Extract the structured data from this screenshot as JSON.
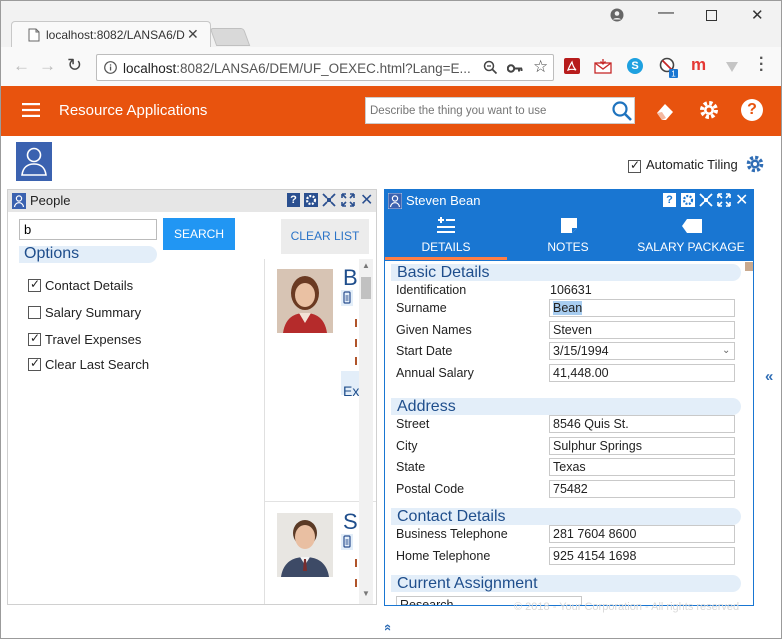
{
  "browser": {
    "tab_title": "localhost:8082/LANSA6/D",
    "url_host": "localhost",
    "url_rest": ":8082/LANSA6/DEM/UF_OEXEC.html?Lang=E..."
  },
  "app": {
    "title": "Resource Applications",
    "search_placeholder": "Describe the thing you want to use",
    "auto_tiling_label": "Automatic Tiling",
    "footer_text": "© 2018 - Your Corporation - All rights reserved",
    "accent_color": "#e8530e",
    "panel_blue": "#1976d2"
  },
  "people_panel": {
    "title": "People",
    "search_value": "b",
    "search_button": "SEARCH",
    "clear_list_button": "CLEAR LIST",
    "options_title": "Options",
    "options": [
      {
        "label": "Contact Details",
        "checked": true
      },
      {
        "label": "Salary Summary",
        "checked": false
      },
      {
        "label": "Travel Expenses",
        "checked": true
      },
      {
        "label": "Clear Last Search",
        "checked": true
      }
    ],
    "cards": [
      {
        "initial": "B",
        "extra": "Ex"
      },
      {
        "initial": "S"
      }
    ]
  },
  "detail_panel": {
    "title": "Steven Bean",
    "tabs": [
      {
        "label": "DETAILS",
        "icon": "list-icon"
      },
      {
        "label": "NOTES",
        "icon": "note-icon"
      },
      {
        "label": "SALARY PACKAGE",
        "icon": "tag-icon"
      }
    ],
    "sections": {
      "basic": "Basic Details",
      "address": "Address",
      "contact": "Contact Details",
      "assignment": "Current Assignment"
    },
    "fields": {
      "identification_label": "Identification",
      "identification": "106631",
      "surname_label": "Surname",
      "surname": "Bean",
      "given_names_label": "Given Names",
      "given_names": "Steven",
      "start_date_label": "Start Date",
      "start_date": "3/15/1994",
      "annual_salary_label": "Annual Salary",
      "annual_salary": "41,448.00",
      "street_label": "Street",
      "street": "8546 Quis St.",
      "city_label": "City",
      "city": "Sulphur Springs",
      "state_label": "State",
      "state": "Texas",
      "postal_label": "Postal Code",
      "postal": "75482",
      "business_tel_label": "Business Telephone",
      "business_tel": "281 7604 8600",
      "home_tel_label": "Home Telephone",
      "home_tel": "925 4154 1698",
      "assignment_value": "Research"
    }
  }
}
